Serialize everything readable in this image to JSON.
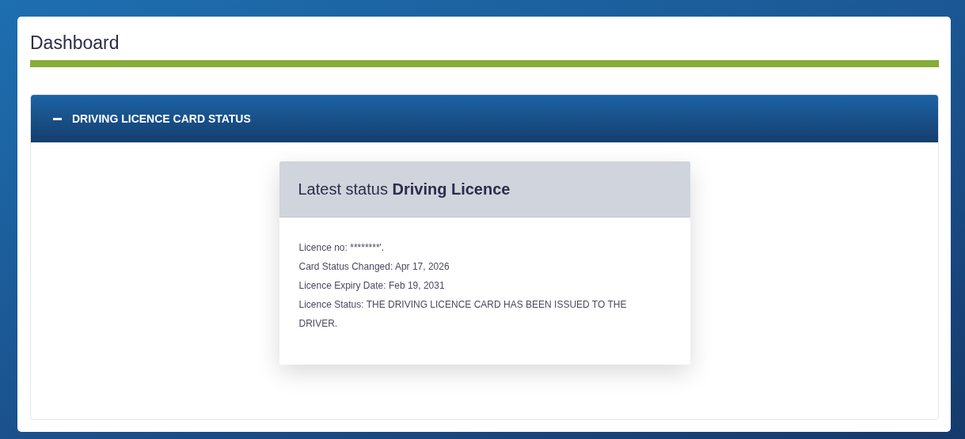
{
  "page": {
    "title": "Dashboard"
  },
  "panel": {
    "title": "DRIVING LICENCE CARD STATUS",
    "expanded": true,
    "status_card": {
      "title": "Latest status **Driving Licence**",
      "lines": [
        "Licence no: ********'.",
        "Card Status Changed: Apr 17, 2026",
        "Licence Expiry Date: Feb 19, 2031",
        "Licence Status: THE DRIVING LICENCE CARD HAS BEEN ISSUED TO THE DRIVER."
      ]
    }
  }
}
